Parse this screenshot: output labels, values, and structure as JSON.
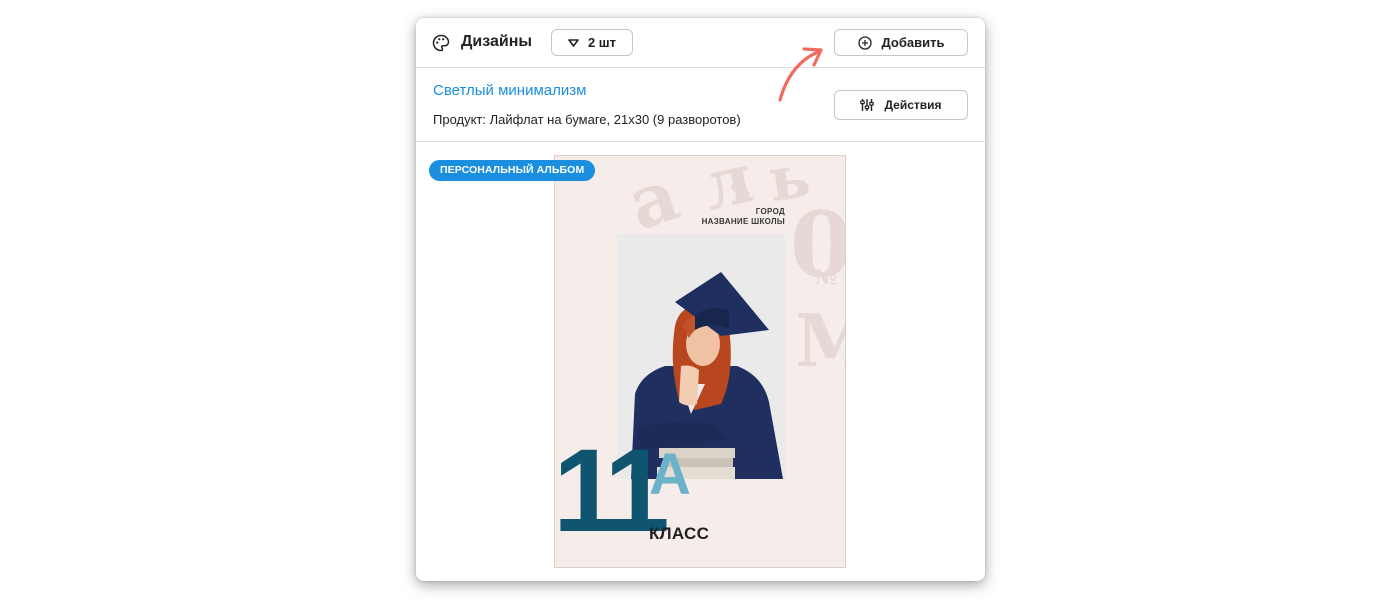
{
  "header": {
    "icon": "palette-icon",
    "title": "Дизайны",
    "count_label": "2 шт",
    "add_label": "Добавить",
    "add_icon": "plus-circle-icon"
  },
  "design": {
    "name": "Светлый минимализм",
    "product": "Продукт: Лайфлат на бумаге, 21х30 (9 разворотов)",
    "actions_label": "Действия",
    "actions_icon": "sliders-icon"
  },
  "preview": {
    "badge": "ПЕРСОНАЛЬНЫЙ АЛЬБОМ",
    "cover": {
      "city": "ГОРОД",
      "school": "НАЗВАНИЕ ШКОЛЫ",
      "grade_number": "11",
      "grade_letter": "А",
      "grade_word": "КЛАСС"
    }
  },
  "colors": {
    "accent": "#1a8fe0",
    "arrow": "#f26b5e",
    "cover_bg": "#f6ecea",
    "grade_dark": "#0f5570",
    "grade_light": "#6ab1c9"
  }
}
